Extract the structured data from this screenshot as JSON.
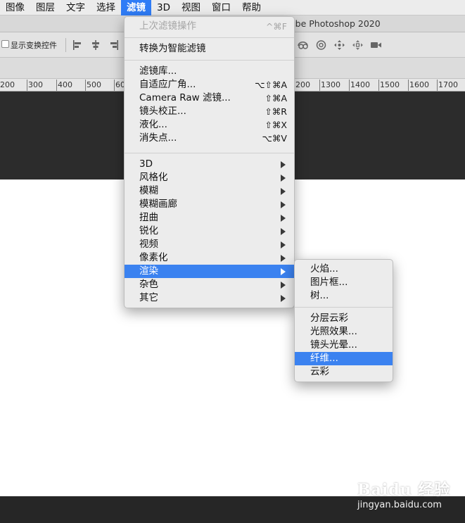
{
  "menubar": {
    "items": [
      {
        "label": "图像"
      },
      {
        "label": "图层"
      },
      {
        "label": "文字"
      },
      {
        "label": "选择"
      },
      {
        "label": "滤镜"
      },
      {
        "label": "3D"
      },
      {
        "label": "视图"
      },
      {
        "label": "窗口"
      },
      {
        "label": "帮助"
      }
    ],
    "active_color": "#2f7cf6"
  },
  "titlebar": {
    "title": "obe Photoshop 2020"
  },
  "options_bar": {
    "show_transform_controls_label": "显示变换控件",
    "show_transform_controls_checked": false
  },
  "ruler": {
    "ticks": [
      "200",
      "300",
      "400",
      "500",
      "60",
      "200",
      "1300",
      "1400",
      "1500",
      "1600",
      "1700"
    ]
  },
  "filter_menu": {
    "last_filter": {
      "label": "上次滤镜操作",
      "shortcut": "^⌘F"
    },
    "convert_smart": {
      "label": "转换为智能滤镜"
    },
    "gallery": {
      "label": "滤镜库..."
    },
    "adaptive_wide_angle": {
      "label": "自适应广角...",
      "shortcut": "⌥⇧⌘A"
    },
    "camera_raw": {
      "label": "Camera Raw 滤镜...",
      "shortcut": "⇧⌘A"
    },
    "lens_correction": {
      "label": "镜头校正...",
      "shortcut": "⇧⌘R"
    },
    "liquify": {
      "label": "液化...",
      "shortcut": "⇧⌘X"
    },
    "vanishing_point": {
      "label": "消失点...",
      "shortcut": "⌥⌘V"
    },
    "submenus": [
      {
        "label": "3D"
      },
      {
        "label": "风格化"
      },
      {
        "label": "模糊"
      },
      {
        "label": "模糊画廊"
      },
      {
        "label": "扭曲"
      },
      {
        "label": "锐化"
      },
      {
        "label": "视频"
      },
      {
        "label": "像素化"
      },
      {
        "label": "渲染"
      },
      {
        "label": "杂色"
      },
      {
        "label": "其它"
      }
    ],
    "highlight_color": "#3b82f0"
  },
  "render_submenu": {
    "items_a": [
      {
        "label": "火焰..."
      },
      {
        "label": "图片框..."
      },
      {
        "label": "树..."
      }
    ],
    "items_b": [
      {
        "label": "分层云彩"
      },
      {
        "label": "光照效果..."
      },
      {
        "label": "镜头光晕..."
      },
      {
        "label": "纤维..."
      },
      {
        "label": "云彩"
      }
    ]
  },
  "watermark": {
    "logo": "Baidu 经验",
    "url": "jingyan.baidu.com"
  }
}
